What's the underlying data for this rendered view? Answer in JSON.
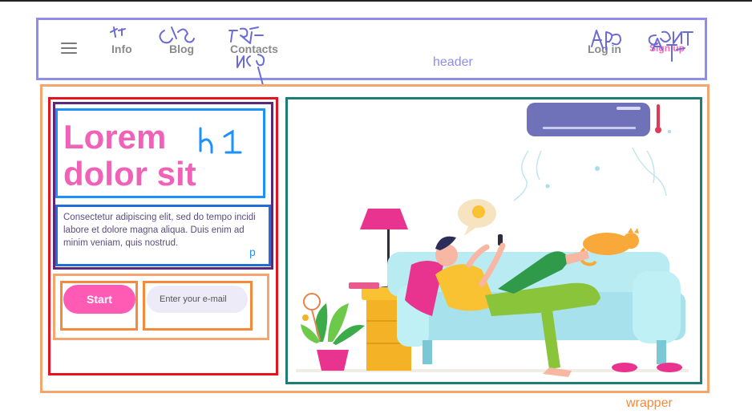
{
  "header": {
    "label": "header",
    "nav": [
      "Info",
      "Blog",
      "Contacts"
    ],
    "login": "Log in",
    "signup": "Sign up",
    "menu_icon": "hamburger-icon"
  },
  "hero": {
    "heading_line1": "Lorem",
    "heading_line2": "dolor sit",
    "paragraph": "Consectetur adipiscing elit, sed do tempo incidi labore et dolore magna aliqua. Duis enim ad minim veniam, quis nostrud.",
    "start_label": "Start",
    "email_placeholder": "Enter your e-mail"
  },
  "annotations": {
    "heading_note": "h1",
    "paragraph_note": "p",
    "wrapper_label": "wrapper"
  },
  "colors": {
    "header_box": "#8e8ee8",
    "wrapper_box": "#f6a66c",
    "column_box": "#e4141e",
    "h1_box": "#1e90ff",
    "illustration_box": "#1f7d77",
    "accent_pink": "#ff5bb5"
  },
  "illustration": {
    "subject": "person relaxing on sofa under air conditioner with cat, lamp and plant"
  }
}
